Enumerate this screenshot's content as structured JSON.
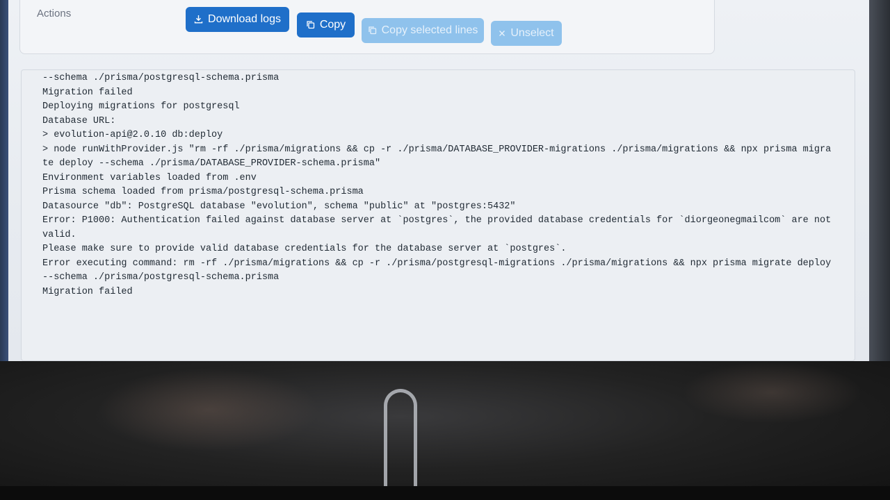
{
  "actions": {
    "label": "Actions",
    "buttons": {
      "download": {
        "label": "Download logs",
        "icon": "download-icon"
      },
      "copy": {
        "label": "Copy",
        "icon": "copy-icon"
      },
      "copy_selected": {
        "label": "Copy selected lines",
        "icon": "copy-icon"
      },
      "unselect": {
        "label": "Unselect",
        "icon": "close-icon"
      }
    }
  },
  "log": {
    "lines": [
      "--schema ./prisma/postgresql-schema.prisma",
      "Migration failed",
      "Deploying migrations for postgresql",
      "Database URL:",
      "> evolution-api@2.0.10 db:deploy",
      "> node runWithProvider.js \"rm -rf ./prisma/migrations && cp -r ./prisma/DATABASE_PROVIDER-migrations ./prisma/migrations && npx prisma migra",
      "te deploy --schema ./prisma/DATABASE_PROVIDER-schema.prisma\"",
      "Environment variables loaded from .env",
      "Prisma schema loaded from prisma/postgresql-schema.prisma",
      "Datasource \"db\": PostgreSQL database \"evolution\", schema \"public\" at \"postgres:5432\"",
      "Error: P1000: Authentication failed against database server at `postgres`, the provided database credentials for `diorgeonegmailcom` are not",
      "valid.",
      "Please make sure to provide valid database credentials for the database server at `postgres`.",
      "Error executing command: rm -rf ./prisma/migrations && cp -r ./prisma/postgresql-migrations ./prisma/migrations && npx prisma migrate deploy",
      "--schema ./prisma/postgresql-schema.prisma",
      "Migration failed"
    ]
  },
  "colors": {
    "primary": "#1f6fc9",
    "disabled": "#8fc2ec",
    "background": "#eef1f5"
  }
}
